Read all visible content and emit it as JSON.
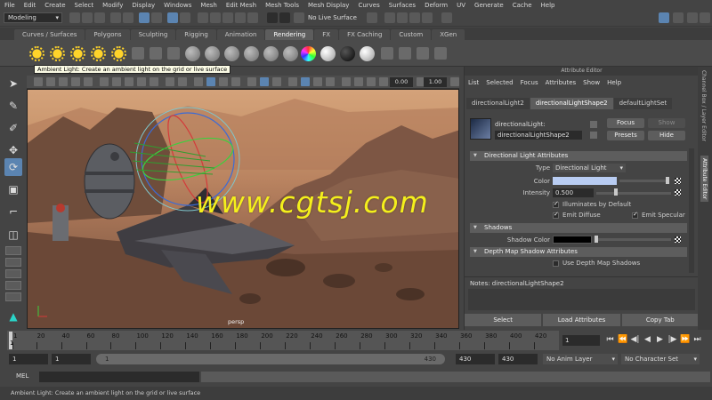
{
  "menubar": {
    "items": [
      "File",
      "Edit",
      "Create",
      "Select",
      "Modify",
      "Display",
      "Windows",
      "Mesh",
      "Edit Mesh",
      "Mesh Tools",
      "Mesh Display",
      "Curves",
      "Surfaces",
      "Deform",
      "UV",
      "Generate",
      "Cache",
      "Help"
    ]
  },
  "statusline": {
    "mode": "Modeling",
    "surface": "No Live Surface"
  },
  "shelf": {
    "tabs": [
      "Curves / Surfaces",
      "Polygons",
      "Sculpting",
      "Rigging",
      "Animation",
      "Rendering",
      "FX",
      "FX Caching",
      "Custom",
      "XGen"
    ],
    "active_tab": "Rendering",
    "tooltip": "Ambient Light: Create an ambient light on the grid or live surface"
  },
  "viewport": {
    "near_clip": "0.00",
    "far_clip": "1.00",
    "camera": "persp",
    "watermark": "www.cgtsj.com"
  },
  "attribute_editor": {
    "title": "Attribute Editor",
    "menu": [
      "List",
      "Selected",
      "Focus",
      "Attributes",
      "Show",
      "Help"
    ],
    "tabs": [
      "directionalLight2",
      "directionalLightShape2",
      "defaultLightSet"
    ],
    "active_tab": "directionalLightShape2",
    "node_type_label": "directionalLight:",
    "node_name": "directionalLightShape2",
    "buttons": {
      "focus": "Focus",
      "presets": "Presets",
      "show": "Show",
      "hide": "Hide"
    },
    "sections": {
      "dl_attrs": "Directional Light Attributes",
      "shadows": "Shadows",
      "depth_map": "Depth Map Shadow Attributes"
    },
    "fields": {
      "type_label": "Type",
      "type_value": "Directional Light",
      "color_label": "Color",
      "color_value": "#b8ccf2",
      "intensity_label": "Intensity",
      "intensity_value": "0.500",
      "illuminates": "Illuminates by Default",
      "emit_diffuse": "Emit Diffuse",
      "emit_specular": "Emit Specular",
      "shadow_color_label": "Shadow Color",
      "shadow_color_value": "#000000",
      "use_depth_map": "Use Depth Map Shadows"
    },
    "notes": "Notes: directionalLightShape2",
    "bottom": {
      "select": "Select",
      "load": "Load Attributes",
      "copy": "Copy Tab"
    }
  },
  "side_tabs": [
    "Channel Box / Layer Editor",
    "Attribute Editor"
  ],
  "timeline": {
    "ticks": [
      "1",
      "20",
      "40",
      "60",
      "80",
      "100",
      "120",
      "140",
      "160",
      "180",
      "200",
      "220",
      "240",
      "260",
      "280",
      "300",
      "320",
      "340",
      "360",
      "380",
      "400",
      "420"
    ],
    "current_frame": "1",
    "current_frame_marker": "1"
  },
  "range": {
    "start": "1",
    "playback_start": "1",
    "slider_start": "1",
    "slider_end": "430",
    "playback_end": "430",
    "end": "430",
    "anim_layer": "No Anim Layer",
    "character_set": "No Character Set"
  },
  "command": {
    "label": "MEL"
  },
  "helpline": "Ambient Light: Create an ambient light on the grid or live surface"
}
